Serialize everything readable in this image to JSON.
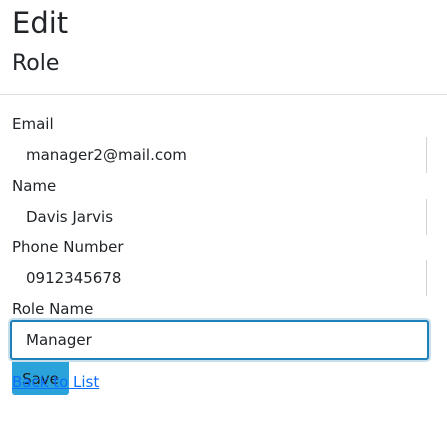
{
  "page": {
    "title": "Edit",
    "section": "Role"
  },
  "form": {
    "fields": [
      {
        "label": "Email",
        "value": "manager2@mail.com"
      },
      {
        "label": "Name",
        "value": "Davis Jarvis"
      },
      {
        "label": "Phone Number",
        "value": "0912345678"
      },
      {
        "label": "Role Name",
        "value": "Manager"
      }
    ],
    "save_label": "Save"
  },
  "back_link": "Back to List",
  "colors": {
    "accent": "#29a3da",
    "focus_border": "#1f7fb8",
    "link": "#0d6efd"
  }
}
